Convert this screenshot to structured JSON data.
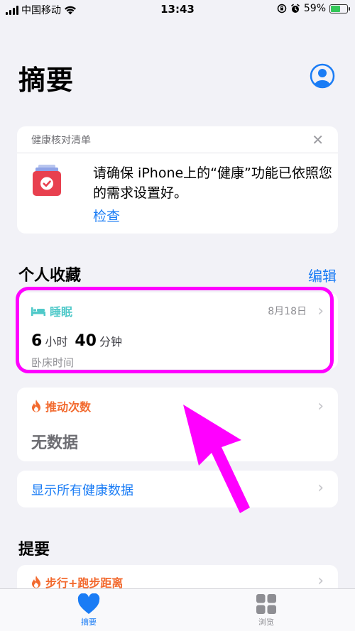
{
  "status_bar": {
    "carrier": "中国移动",
    "time": "13:43",
    "battery": "59%",
    "battery_level": 0.59
  },
  "header": {
    "title": "摘要"
  },
  "checklist": {
    "title": "健康核对清单",
    "message": "请确保 iPhone上的“健康”功能已依照您的需求设置好。",
    "link": "检查"
  },
  "favorites": {
    "title": "个人收藏",
    "edit": "编辑",
    "sleep": {
      "label": "睡眠",
      "date": "8月18日",
      "hours": "6",
      "hours_unit": "小时",
      "minutes": "40",
      "minutes_unit": "分钟",
      "subtitle": "卧床时间"
    },
    "push": {
      "label": "推动次数",
      "value": "无数据"
    },
    "show_all": "显示所有健康数据"
  },
  "highlights": {
    "title": "提要",
    "item": "步行+跑步距离"
  },
  "tabs": {
    "summary": "摘要",
    "browse": "浏览"
  },
  "colors": {
    "accent": "#1a7cf5",
    "sleep": "#4fc9c9",
    "activity": "#f26a2f",
    "annotation": "#ff00ff"
  }
}
